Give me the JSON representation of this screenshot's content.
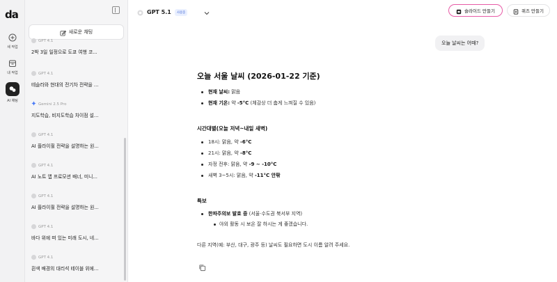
{
  "rail": {
    "logo": "da",
    "items": [
      {
        "label": "새 작업",
        "icon": "plus-circle-icon"
      },
      {
        "label": "내 작업",
        "icon": "archive-icon"
      },
      {
        "label": "AI 채팅",
        "icon": "chat-bubbles-icon",
        "active": true
      }
    ]
  },
  "sidebar": {
    "new_chat_label": "새로운 채팅",
    "chats": [
      {
        "model": "GPT 4.1",
        "title": "2박 3일 일정으로 도쿄 여행 코..."
      },
      {
        "model": "GPT 4.1",
        "title": "테슬라와 현대의 전기차 전략을 ..."
      },
      {
        "model": "Gemini 2.5 Pro",
        "title": "지도학습, 비지도학습 차이점 설..."
      },
      {
        "model": "GPT 4.1",
        "title": "AI 플라이휠 전략을 설명하는 원..."
      },
      {
        "model": "GPT 4.1",
        "title": "AI 노트 앱 프로모션 배너, 미니..."
      },
      {
        "model": "GPT 4.1",
        "title": "AI 플라이휠 전략을 설명하는 원..."
      },
      {
        "model": "GPT 4.1",
        "title": "바다 위에 떠 있는 미래 도시, 네..."
      },
      {
        "model": "GPT 4.1",
        "title": "흰색 배경의 대리석 테이블 위에..."
      }
    ]
  },
  "topbar": {
    "model_name": "GPT 5.1",
    "model_badge": "사용중",
    "slide_button": "슬라이드 만들기",
    "quiz_button": "퀴즈 만들기"
  },
  "conversation": {
    "user_message": "오늘 날씨는 어때?",
    "answer_title": "오늘 서울 날씨 (2026-01-22 기준)",
    "current": [
      {
        "key": "현재 날씨:",
        "value": " 맑음",
        "strong": ""
      },
      {
        "key": "현재 기온:",
        "value": " 약 ",
        "strong": "-5°C",
        "tail": " (체감상 더 춥게 느껴질 수 있음)"
      }
    ],
    "hourly_heading": "시간대별(오늘 저녁~내일 새벽)",
    "hourly": [
      {
        "text": "18시: 맑음, 약 ",
        "strong": "-6°C"
      },
      {
        "text": "21시: 맑음, 약 ",
        "strong": "-8°C"
      },
      {
        "text": "자정 전후: 맑음, 약 ",
        "strong": "-9 ~ -10°C"
      },
      {
        "text": "새벽 3~5시: 맑음, 약 ",
        "strong": "-11°C 안팎"
      }
    ],
    "alert_heading": "특보",
    "alert_key": "한파주의보 발효 중",
    "alert_value": " (서울·수도권 북서부 지역)",
    "alert_sub": "야외 활동 시 보온 잘 하시는 게 좋겠습니다.",
    "footer": "다른 지역(예: 부산, 대구, 광주 등) 날씨도 필요하면 도시 이름 알려 주세요."
  },
  "colors": {
    "accent_pink": "#e75aa6",
    "badge_blue": "#4a6fd8",
    "gemini_blue": "#4a7bf7"
  }
}
